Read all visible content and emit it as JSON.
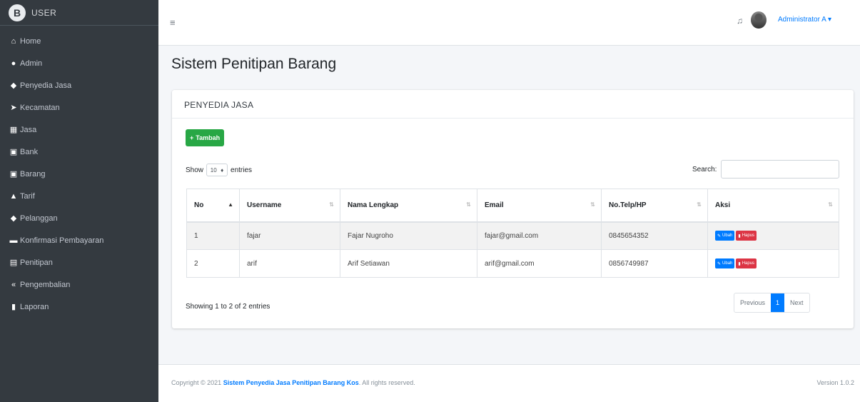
{
  "brand": {
    "logo": "B",
    "name": "USER"
  },
  "sidebar": {
    "items": [
      {
        "icon": "⌂",
        "label": "Home"
      },
      {
        "icon": "●",
        "label": "Admin"
      },
      {
        "icon": "◆",
        "label": "Penyedia Jasa"
      },
      {
        "icon": "➤",
        "label": "Kecamatan"
      },
      {
        "icon": "▦",
        "label": "Jasa"
      },
      {
        "icon": "▣",
        "label": "Bank"
      },
      {
        "icon": "▣",
        "label": "Barang"
      },
      {
        "icon": "▲",
        "label": "Tarif"
      },
      {
        "icon": "◆",
        "label": "Pelanggan"
      },
      {
        "icon": "▬",
        "label": "Konfirmasi Pembayaran"
      },
      {
        "icon": "▤",
        "label": "Penitipan"
      },
      {
        "icon": "«",
        "label": "Pengembalian"
      },
      {
        "icon": "▮",
        "label": "Laporan"
      }
    ]
  },
  "topbar": {
    "menu_icon": "≡",
    "bell_icon": "♫",
    "user_name": "Administrator A ▾"
  },
  "page": {
    "title": "Sistem Penitipan Barang"
  },
  "card": {
    "header": "PENYEDIA JASA",
    "add_button": "Tambah",
    "show_label": "Show",
    "entries_select": "10",
    "entries_label": "entries",
    "search_label": "Search:"
  },
  "table": {
    "columns": [
      "No",
      "Username",
      "Nama Lengkap",
      "Email",
      "No.Telp/HP",
      "Aksi"
    ],
    "rows": [
      {
        "no": "1",
        "username": "fajar",
        "nama": "Fajar Nugroho",
        "email": "fajar@gmail.com",
        "telp": "0845654352"
      },
      {
        "no": "2",
        "username": "arif",
        "nama": "Arif Setiawan",
        "email": "arif@gmail.com",
        "telp": "0856749987"
      }
    ],
    "edit_label": "Ubah",
    "delete_label": "Hapus"
  },
  "footer_info": "Showing 1 to 2 of 2 entries",
  "pagination": {
    "prev": "Previous",
    "current": "1",
    "next": "Next"
  },
  "footer": {
    "copyright_prefix": "Copyright © 2021 ",
    "copyright_link": "Sistem Penyedia Jasa Penitipan Barang Kos",
    "copyright_suffix": ". All rights reserved.",
    "version": "Version 1.0.2"
  }
}
